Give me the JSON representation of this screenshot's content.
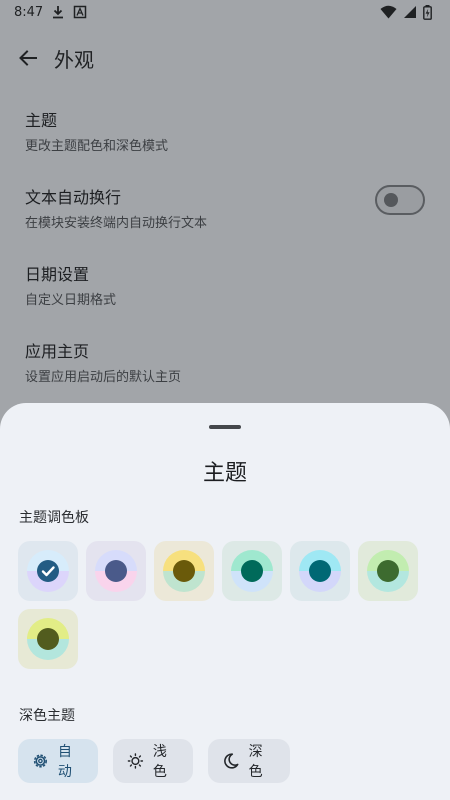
{
  "status_bar": {
    "time": "8:47"
  },
  "header": {
    "title": "外观"
  },
  "settings": [
    {
      "title": "主题",
      "subtitle": "更改主题配色和深色模式"
    },
    {
      "title": "文本自动换行",
      "subtitle": "在模块安装终端内自动换行文本",
      "toggle_on": false
    },
    {
      "title": "日期设置",
      "subtitle": "自定义日期格式"
    },
    {
      "title": "应用主页",
      "subtitle": "设置应用启动后的默认主页"
    }
  ],
  "sheet": {
    "title": "主题",
    "palette_label": "主题调色板",
    "swatches": [
      {
        "top": "#d7ecfb",
        "bottom": "#dcd5fb",
        "center": "#235c84",
        "bg": "#dfe7ef",
        "selected": true
      },
      {
        "top": "#d7dcfb",
        "bottom": "#f9d4ec",
        "center": "#4a5a8a",
        "bg": "#e4e3ef",
        "selected": false
      },
      {
        "top": "#f7e07e",
        "bottom": "#bfe4cf",
        "center": "#6a5a0a",
        "bg": "#ece8d8",
        "selected": false
      },
      {
        "top": "#9fe8cf",
        "bottom": "#cfe3fa",
        "center": "#006a5a",
        "bg": "#dde9e6",
        "selected": false
      },
      {
        "top": "#9fe8f4",
        "bottom": "#d3d7fa",
        "center": "#006874",
        "bg": "#dde8ec",
        "selected": false
      },
      {
        "top": "#c2edb0",
        "bottom": "#b3e7df",
        "center": "#3d6b2f",
        "bg": "#e1eadb",
        "selected": false
      },
      {
        "top": "#e2ed86",
        "bottom": "#b3e6dd",
        "center": "#525c1e",
        "bg": "#e7e9d5",
        "selected": false
      }
    ],
    "dark_label": "深色主题",
    "modes": [
      {
        "label": "自动",
        "icon": "gear-icon",
        "selected": true
      },
      {
        "label": "浅色",
        "icon": "sun-icon",
        "selected": false
      },
      {
        "label": "深色",
        "icon": "moon-icon",
        "selected": false
      }
    ]
  },
  "colors": {
    "accent": "#235c84",
    "scrim": "#a2a5a9",
    "sheet": "#eef1f6"
  }
}
